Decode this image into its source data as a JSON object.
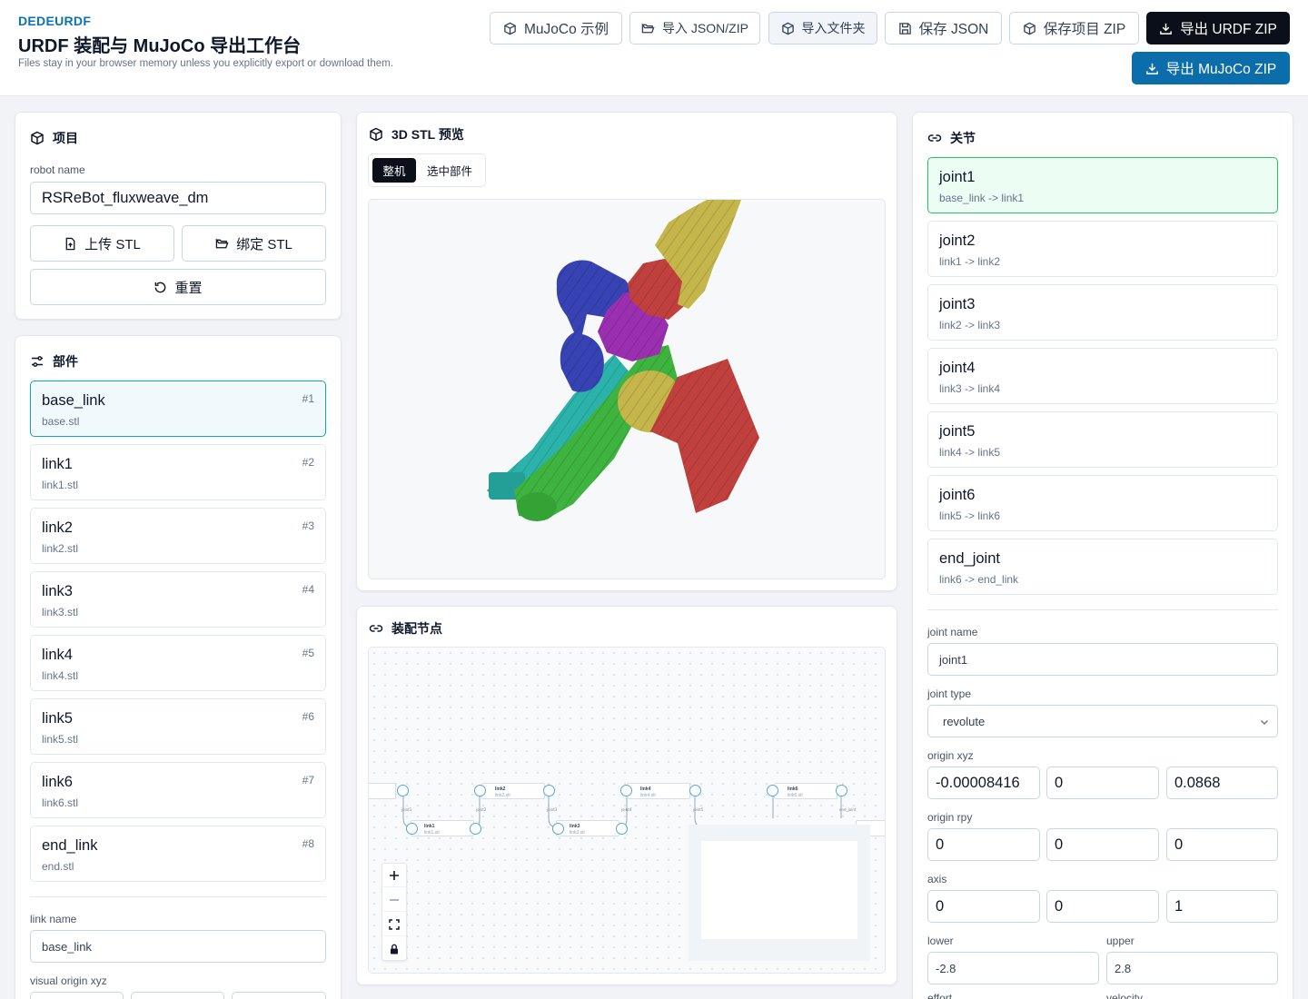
{
  "header": {
    "brand": "DEDEURDF",
    "title": "URDF 装配与 MuJoCo 导出工作台",
    "subtitle": "Files stay in your browser memory unless you explicitly export or download them.",
    "buttons": {
      "mujoco_example": "MuJoCo 示例",
      "import_json_zip": "导入 JSON/ZIP",
      "import_folder": "导入文件夹",
      "save_json": "保存 JSON",
      "save_project_zip": "保存项目 ZIP",
      "export_urdf_zip": "导出 URDF ZIP",
      "export_mujoco_zip": "导出 MuJoCo ZIP"
    }
  },
  "project": {
    "title": "项目",
    "robot_name_label": "robot name",
    "robot_name": "RSReBot_fluxweave_dm",
    "upload_stl": "上传 STL",
    "bind_stl": "绑定 STL",
    "reset": "重置"
  },
  "parts": {
    "title": "部件",
    "items": [
      {
        "name": "base_link",
        "file": "base.stl",
        "index": "#1"
      },
      {
        "name": "link1",
        "file": "link1.stl",
        "index": "#2"
      },
      {
        "name": "link2",
        "file": "link2.stl",
        "index": "#3"
      },
      {
        "name": "link3",
        "file": "link3.stl",
        "index": "#4"
      },
      {
        "name": "link4",
        "file": "link4.stl",
        "index": "#5"
      },
      {
        "name": "link5",
        "file": "link5.stl",
        "index": "#6"
      },
      {
        "name": "link6",
        "file": "link6.stl",
        "index": "#7"
      },
      {
        "name": "end_link",
        "file": "end.stl",
        "index": "#8"
      }
    ],
    "link_name_label": "link name",
    "link_name": "base_link",
    "visual_origin_label": "visual origin xyz"
  },
  "preview": {
    "title": "3D STL 预览",
    "tab_whole": "整机",
    "tab_selected": "选中部件"
  },
  "graph": {
    "title": "装配节点",
    "nodes": [
      {
        "title": "link2",
        "file": "link2.stl"
      },
      {
        "title": "link4",
        "file": "link4.stl"
      },
      {
        "title": "link6",
        "file": "link6.stl"
      },
      {
        "title": "link1",
        "file": "link1.stl"
      },
      {
        "title": "link3",
        "file": "link3.stl"
      }
    ],
    "edges": [
      "joint1",
      "joint2",
      "joint3",
      "joint4",
      "joint5",
      "end_joint"
    ]
  },
  "joints": {
    "title": "关节",
    "items": [
      {
        "name": "joint1",
        "rel": "base_link -> link1"
      },
      {
        "name": "joint2",
        "rel": "link1 -> link2"
      },
      {
        "name": "joint3",
        "rel": "link2 -> link3"
      },
      {
        "name": "joint4",
        "rel": "link3 -> link4"
      },
      {
        "name": "joint5",
        "rel": "link4 -> link5"
      },
      {
        "name": "joint6",
        "rel": "link5 -> link6"
      },
      {
        "name": "end_joint",
        "rel": "link6 -> end_link"
      }
    ],
    "joint_name_label": "joint name",
    "joint_name": "joint1",
    "joint_type_label": "joint type",
    "joint_type": "revolute",
    "origin_xyz_label": "origin xyz",
    "origin_xyz": [
      "-0.00008416",
      "0",
      "0.0868"
    ],
    "origin_rpy_label": "origin rpy",
    "origin_rpy": [
      "0",
      "0",
      "0"
    ],
    "axis_label": "axis",
    "axis": [
      "0",
      "0",
      "1"
    ],
    "lower_label": "lower",
    "lower": "-2.8",
    "upper_label": "upper",
    "upper": "2.8",
    "effort_label": "effort",
    "velocity_label": "velocity"
  },
  "colors": {
    "brand": "#0b72b5",
    "export_blue": "#0b6eab",
    "selected_part": "#0ea5b7",
    "selected_joint": "#22c55e"
  }
}
